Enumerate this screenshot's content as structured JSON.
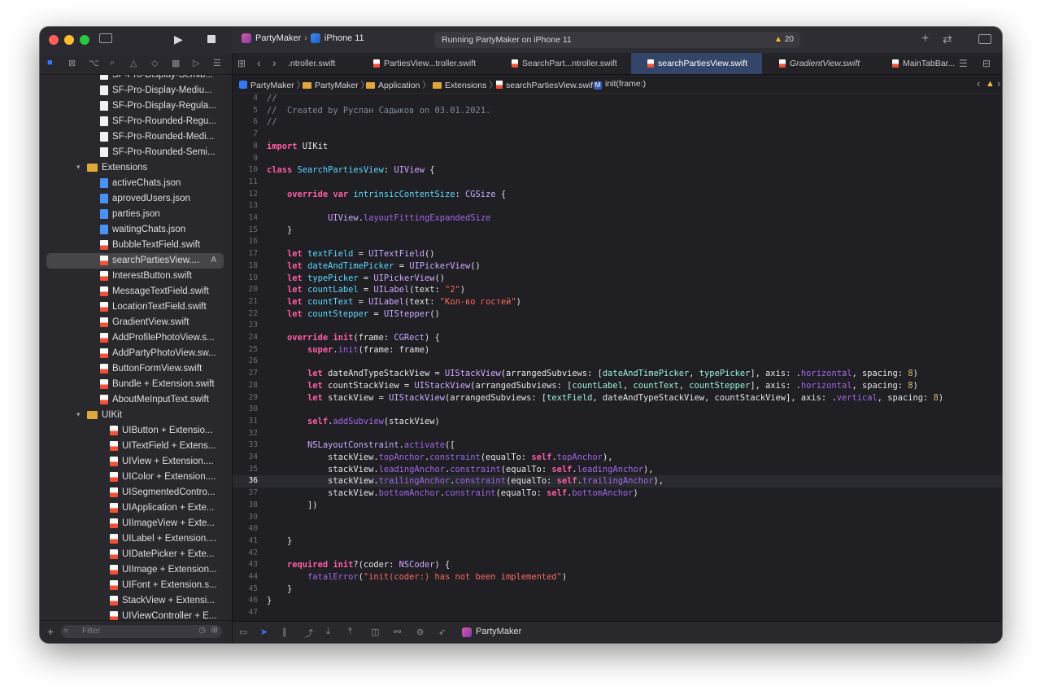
{
  "toolbar": {
    "scheme": "PartyMaker",
    "device": "iPhone 11",
    "status": "Running PartyMaker on iPhone 11",
    "warning_count": "20"
  },
  "tabs": [
    {
      "label": ".ntroller.swift",
      "active": false
    },
    {
      "label": "PartiesView...troller.swift",
      "active": false
    },
    {
      "label": "SearchPart...ntroller.swift",
      "active": false
    },
    {
      "label": "searchPartiesView.swift",
      "active": true
    },
    {
      "label": "GradientView.swift",
      "active": false
    },
    {
      "label": "MainTabBar...",
      "active": false
    }
  ],
  "breadcrumb": [
    "PartyMaker",
    "PartyMaker",
    "Application",
    "Extensions",
    "searchPartiesView.swift",
    "init(frame:)"
  ],
  "navigator": {
    "filter_placeholder": "Filter",
    "items": [
      {
        "label": "SF-Pro-Display-Semib...",
        "kind": "font",
        "indent": 1
      },
      {
        "label": "SF-Pro-Display-Mediu...",
        "kind": "font",
        "indent": 1
      },
      {
        "label": "SF-Pro-Display-Regula...",
        "kind": "font",
        "indent": 1
      },
      {
        "label": "SF-Pro-Rounded-Regu...",
        "kind": "font",
        "indent": 1
      },
      {
        "label": "SF-Pro-Rounded-Medi...",
        "kind": "font",
        "indent": 1
      },
      {
        "label": "SF-Pro-Rounded-Semi...",
        "kind": "font",
        "indent": 1
      },
      {
        "label": "Extensions",
        "kind": "folder",
        "indent": 0
      },
      {
        "label": "activeChats.json",
        "kind": "json",
        "indent": 1
      },
      {
        "label": "aprovedUsers.json",
        "kind": "json",
        "indent": 1
      },
      {
        "label": "parties.json",
        "kind": "json",
        "indent": 1
      },
      {
        "label": "waitingChats.json",
        "kind": "json",
        "indent": 1
      },
      {
        "label": "BubbleTextField.swift",
        "kind": "swift",
        "indent": 1
      },
      {
        "label": "searchPartiesView....",
        "kind": "swift",
        "indent": 1,
        "selected": true,
        "badge": "A"
      },
      {
        "label": "InterestButton.swift",
        "kind": "swift",
        "indent": 1
      },
      {
        "label": "MessageTextField.swift",
        "kind": "swift",
        "indent": 1
      },
      {
        "label": "LocationTextField.swift",
        "kind": "swift",
        "indent": 1
      },
      {
        "label": "GradientView.swift",
        "kind": "swift",
        "indent": 1
      },
      {
        "label": "AddProfilePhotoView.s...",
        "kind": "swift",
        "indent": 1
      },
      {
        "label": "AddPartyPhotoView.sw...",
        "kind": "swift",
        "indent": 1
      },
      {
        "label": "ButtonFormView.swift",
        "kind": "swift",
        "indent": 1
      },
      {
        "label": "Bundle + Extension.swift",
        "kind": "swift",
        "indent": 1
      },
      {
        "label": "AboutMeInputText.swift",
        "kind": "swift",
        "indent": 1
      },
      {
        "label": "UIKit",
        "kind": "folder",
        "indent": 1
      },
      {
        "label": "UIButton + Extensio...",
        "kind": "swift",
        "indent": 2
      },
      {
        "label": "UITextField + Extens...",
        "kind": "swift",
        "indent": 2
      },
      {
        "label": "UIView + Extension....",
        "kind": "swift",
        "indent": 2
      },
      {
        "label": "UIColor + Extension....",
        "kind": "swift",
        "indent": 2
      },
      {
        "label": "UISegmentedContro...",
        "kind": "swift",
        "indent": 2
      },
      {
        "label": "UIApplication + Exte...",
        "kind": "swift",
        "indent": 2
      },
      {
        "label": "UIImageView + Exte...",
        "kind": "swift",
        "indent": 2
      },
      {
        "label": "UILabel + Extension....",
        "kind": "swift",
        "indent": 2
      },
      {
        "label": "UIDatePicker + Exte...",
        "kind": "swift",
        "indent": 2
      },
      {
        "label": "UIImage + Extension...",
        "kind": "swift",
        "indent": 2
      },
      {
        "label": "UIFont + Extension.s...",
        "kind": "swift",
        "indent": 2
      },
      {
        "label": "StackView + Extensi...",
        "kind": "swift",
        "indent": 2
      },
      {
        "label": "UIViewController + E...",
        "kind": "swift",
        "indent": 2
      }
    ]
  },
  "editor": {
    "current_line": 36,
    "lines": [
      {
        "n": 4,
        "t": [
          [
            "c",
            "//"
          ]
        ]
      },
      {
        "n": 5,
        "t": [
          [
            "c",
            "//  Created by Руслан Садыков on 03.01.2021."
          ]
        ]
      },
      {
        "n": 6,
        "t": [
          [
            "c",
            "//"
          ]
        ]
      },
      {
        "n": 7,
        "t": []
      },
      {
        "n": 8,
        "t": [
          [
            "k",
            "import"
          ],
          [
            "p",
            " UIKit"
          ]
        ]
      },
      {
        "n": 9,
        "t": []
      },
      {
        "n": 10,
        "t": [
          [
            "k",
            "class"
          ],
          [
            "p",
            " "
          ],
          [
            "d",
            "SearchPartiesView"
          ],
          [
            "p",
            ": "
          ],
          [
            "y",
            "UIView"
          ],
          [
            "p",
            " {"
          ]
        ]
      },
      {
        "n": 11,
        "t": []
      },
      {
        "n": 12,
        "t": [
          [
            "p",
            "    "
          ],
          [
            "k",
            "override var"
          ],
          [
            "p",
            " "
          ],
          [
            "d",
            "intrinsicContentSize"
          ],
          [
            "p",
            ": "
          ],
          [
            "y",
            "CGSize"
          ],
          [
            "p",
            " {"
          ]
        ]
      },
      {
        "n": 13,
        "t": []
      },
      {
        "n": 14,
        "t": [
          [
            "p",
            "            "
          ],
          [
            "y",
            "UIView"
          ],
          [
            "p",
            "."
          ],
          [
            "m",
            "layoutFittingExpandedSize"
          ]
        ]
      },
      {
        "n": 15,
        "t": [
          [
            "p",
            "    }"
          ]
        ]
      },
      {
        "n": 16,
        "t": []
      },
      {
        "n": 17,
        "t": [
          [
            "p",
            "    "
          ],
          [
            "k",
            "let"
          ],
          [
            "p",
            " "
          ],
          [
            "d",
            "textField"
          ],
          [
            "p",
            " = "
          ],
          [
            "y",
            "UITextField"
          ],
          [
            "p",
            "()"
          ]
        ]
      },
      {
        "n": 18,
        "t": [
          [
            "p",
            "    "
          ],
          [
            "k",
            "let"
          ],
          [
            "p",
            " "
          ],
          [
            "d",
            "dateAndTimePicker"
          ],
          [
            "p",
            " = "
          ],
          [
            "y",
            "UIPickerView"
          ],
          [
            "p",
            "()"
          ]
        ]
      },
      {
        "n": 19,
        "t": [
          [
            "p",
            "    "
          ],
          [
            "k",
            "let"
          ],
          [
            "p",
            " "
          ],
          [
            "d",
            "typePicker"
          ],
          [
            "p",
            " = "
          ],
          [
            "y",
            "UIPickerView"
          ],
          [
            "p",
            "()"
          ]
        ]
      },
      {
        "n": 20,
        "t": [
          [
            "p",
            "    "
          ],
          [
            "k",
            "let"
          ],
          [
            "p",
            " "
          ],
          [
            "d",
            "countLabel"
          ],
          [
            "p",
            " = "
          ],
          [
            "y",
            "UILabel"
          ],
          [
            "p",
            "(text: "
          ],
          [
            "s",
            "\"2\""
          ],
          [
            "p",
            ")"
          ]
        ]
      },
      {
        "n": 21,
        "t": [
          [
            "p",
            "    "
          ],
          [
            "k",
            "let"
          ],
          [
            "p",
            " "
          ],
          [
            "d",
            "countText"
          ],
          [
            "p",
            " = "
          ],
          [
            "y",
            "UILabel"
          ],
          [
            "p",
            "(text: "
          ],
          [
            "s",
            "\"Кол-во гостей\""
          ],
          [
            "p",
            ")"
          ]
        ]
      },
      {
        "n": 22,
        "t": [
          [
            "p",
            "    "
          ],
          [
            "k",
            "let"
          ],
          [
            "p",
            " "
          ],
          [
            "d",
            "countStepper"
          ],
          [
            "p",
            " = "
          ],
          [
            "y",
            "UIStepper"
          ],
          [
            "p",
            "()"
          ]
        ]
      },
      {
        "n": 23,
        "t": []
      },
      {
        "n": 24,
        "t": [
          [
            "p",
            "    "
          ],
          [
            "k",
            "override init"
          ],
          [
            "p",
            "(frame: "
          ],
          [
            "y",
            "CGRect"
          ],
          [
            "p",
            ") {"
          ]
        ]
      },
      {
        "n": 25,
        "t": [
          [
            "p",
            "        "
          ],
          [
            "k",
            "super"
          ],
          [
            "p",
            "."
          ],
          [
            "m",
            "init"
          ],
          [
            "p",
            "(frame: frame)"
          ]
        ]
      },
      {
        "n": 26,
        "t": []
      },
      {
        "n": 27,
        "t": [
          [
            "p",
            "        "
          ],
          [
            "k",
            "let"
          ],
          [
            "p",
            " dateAndTypeStackView = "
          ],
          [
            "y",
            "UIStackView"
          ],
          [
            "p",
            "(arrangedSubviews: ["
          ],
          [
            "t",
            "dateAndTimePicker"
          ],
          [
            "p",
            ", "
          ],
          [
            "t",
            "typePicker"
          ],
          [
            "p",
            "], axis: ."
          ],
          [
            "m",
            "horizontal"
          ],
          [
            "p",
            ", spacing: "
          ],
          [
            "n",
            "8"
          ],
          [
            "p",
            ")"
          ]
        ]
      },
      {
        "n": 28,
        "t": [
          [
            "p",
            "        "
          ],
          [
            "k",
            "let"
          ],
          [
            "p",
            " countStackView = "
          ],
          [
            "y",
            "UIStackView"
          ],
          [
            "p",
            "(arrangedSubviews: ["
          ],
          [
            "t",
            "countLabel"
          ],
          [
            "p",
            ", "
          ],
          [
            "t",
            "countText"
          ],
          [
            "p",
            ", "
          ],
          [
            "t",
            "countStepper"
          ],
          [
            "p",
            "], axis: ."
          ],
          [
            "m",
            "horizontal"
          ],
          [
            "p",
            ", spacing: "
          ],
          [
            "n",
            "8"
          ],
          [
            "p",
            ")"
          ]
        ]
      },
      {
        "n": 29,
        "t": [
          [
            "p",
            "        "
          ],
          [
            "k",
            "let"
          ],
          [
            "p",
            " stackView = "
          ],
          [
            "y",
            "UIStackView"
          ],
          [
            "p",
            "(arrangedSubviews: ["
          ],
          [
            "t",
            "textField"
          ],
          [
            "p",
            ", dateAndTypeStackView, countStackView], axis: ."
          ],
          [
            "m",
            "vertical"
          ],
          [
            "p",
            ", spacing: "
          ],
          [
            "n",
            "8"
          ],
          [
            "p",
            ")"
          ]
        ]
      },
      {
        "n": 30,
        "t": []
      },
      {
        "n": 31,
        "t": [
          [
            "p",
            "        "
          ],
          [
            "k",
            "self"
          ],
          [
            "p",
            "."
          ],
          [
            "m",
            "addSubview"
          ],
          [
            "p",
            "(stackView)"
          ]
        ]
      },
      {
        "n": 32,
        "t": []
      },
      {
        "n": 33,
        "t": [
          [
            "p",
            "        "
          ],
          [
            "y",
            "NSLayoutConstraint"
          ],
          [
            "p",
            "."
          ],
          [
            "m",
            "activate"
          ],
          [
            "p",
            "(["
          ]
        ]
      },
      {
        "n": 34,
        "t": [
          [
            "p",
            "            stackView."
          ],
          [
            "m",
            "topAnchor"
          ],
          [
            "p",
            "."
          ],
          [
            "m",
            "constraint"
          ],
          [
            "p",
            "(equalTo: "
          ],
          [
            "k",
            "self"
          ],
          [
            "p",
            "."
          ],
          [
            "m",
            "topAnchor"
          ],
          [
            "p",
            "),"
          ]
        ]
      },
      {
        "n": 35,
        "t": [
          [
            "p",
            "            stackView."
          ],
          [
            "m",
            "leadingAnchor"
          ],
          [
            "p",
            "."
          ],
          [
            "m",
            "constraint"
          ],
          [
            "p",
            "(equalTo: "
          ],
          [
            "k",
            "self"
          ],
          [
            "p",
            "."
          ],
          [
            "m",
            "leadingAnchor"
          ],
          [
            "p",
            "),"
          ]
        ]
      },
      {
        "n": 36,
        "t": [
          [
            "p",
            "            stackView."
          ],
          [
            "m",
            "trailingAnchor"
          ],
          [
            "p",
            "."
          ],
          [
            "m",
            "constraint"
          ],
          [
            "p",
            "(equalTo: "
          ],
          [
            "k",
            "self"
          ],
          [
            "p",
            "."
          ],
          [
            "m",
            "trailingAnchor"
          ],
          [
            "p",
            "),"
          ]
        ]
      },
      {
        "n": 37,
        "t": [
          [
            "p",
            "            stackView."
          ],
          [
            "m",
            "bottomAnchor"
          ],
          [
            "p",
            "."
          ],
          [
            "m",
            "constraint"
          ],
          [
            "p",
            "(equalTo: "
          ],
          [
            "k",
            "self"
          ],
          [
            "p",
            "."
          ],
          [
            "m",
            "bottomAnchor"
          ],
          [
            "p",
            ")"
          ]
        ]
      },
      {
        "n": 38,
        "t": [
          [
            "p",
            "        ])"
          ]
        ]
      },
      {
        "n": 39,
        "t": []
      },
      {
        "n": 40,
        "t": []
      },
      {
        "n": 41,
        "t": [
          [
            "p",
            "    }"
          ]
        ]
      },
      {
        "n": 42,
        "t": []
      },
      {
        "n": 43,
        "t": [
          [
            "p",
            "    "
          ],
          [
            "k",
            "required init"
          ],
          [
            "p",
            "?(coder: "
          ],
          [
            "y",
            "NSCoder"
          ],
          [
            "p",
            ") {"
          ]
        ]
      },
      {
        "n": 44,
        "t": [
          [
            "p",
            "        "
          ],
          [
            "m",
            "fatalError"
          ],
          [
            "p",
            "("
          ],
          [
            "s",
            "\"init(coder:) has not been implemented\""
          ],
          [
            "p",
            ")"
          ]
        ]
      },
      {
        "n": 45,
        "t": [
          [
            "p",
            "    }"
          ]
        ]
      },
      {
        "n": 46,
        "t": [
          [
            "p",
            "}"
          ]
        ]
      },
      {
        "n": 47,
        "t": []
      }
    ]
  },
  "debugbar": {
    "target": "PartyMaker"
  },
  "colors": {
    "accent": "#3478f6",
    "tab_active": "#34456a",
    "warning": "#f3c13a"
  }
}
